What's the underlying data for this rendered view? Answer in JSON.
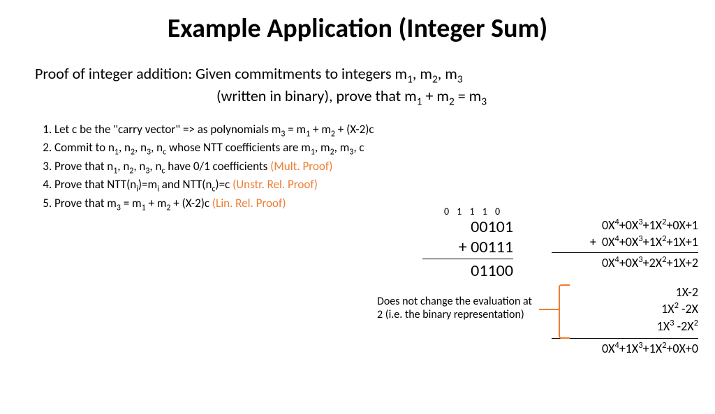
{
  "title": "Example Application (Integer Sum)",
  "intro": {
    "line1_a": "Proof of integer addition: Given commitments to integers m",
    "line1_b": ", m",
    "line1_c": ", m",
    "line2_a": "(written in binary), prove that m",
    "line2_b": " + m",
    "line2_c": " = m"
  },
  "steps": {
    "s1_a": "Let c be the \"carry vector\" => as polynomials m",
    "s1_b": " = m",
    "s1_c": " + m",
    "s1_d": " + (X-2)c",
    "s2_a": "Commit to n",
    "s2_b": ", n",
    "s2_c": ", n",
    "s2_d": ", n",
    "s2_e": " whose NTT coefficients are m",
    "s2_f": ", m",
    "s2_g": ", m",
    "s2_h": ", c",
    "s3_a": "Prove that n",
    "s3_b": ", n",
    "s3_c": ", n",
    "s3_d": ", n",
    "s3_e": " have 0/1 coefficients ",
    "s3_proof": "(Mult. Proof)",
    "s4_a": "Prove that NTT(n",
    "s4_b": ")=m",
    "s4_c": " and NTT(n",
    "s4_d": ")=c  ",
    "s4_proof": "(Unstr. Rel. Proof)",
    "s5_a": "Prove that m",
    "s5_b": " = m",
    "s5_c": " + m",
    "s5_d": " + (X-2)c  ",
    "s5_proof": "(Lin. Rel. Proof)"
  },
  "carry": "0 1 1 1 0",
  "bin": {
    "a": "00101",
    "b": "+  00111",
    "sum": "01100"
  },
  "poly": {
    "a": "0X⁴+0X³+1X²+0X+1",
    "b": "+  0X⁴+0X³+1X²+1X+1",
    "sum": "0X⁴+0X³+2X²+1X+2",
    "c1": "1X-2",
    "c2": "1X² -2X",
    "c3": "1X³ -2X²",
    "result": "0X⁴+1X³+1X²+0X+0"
  },
  "note": "Does not change the evaluation at 2 (i.e. the binary representation)"
}
